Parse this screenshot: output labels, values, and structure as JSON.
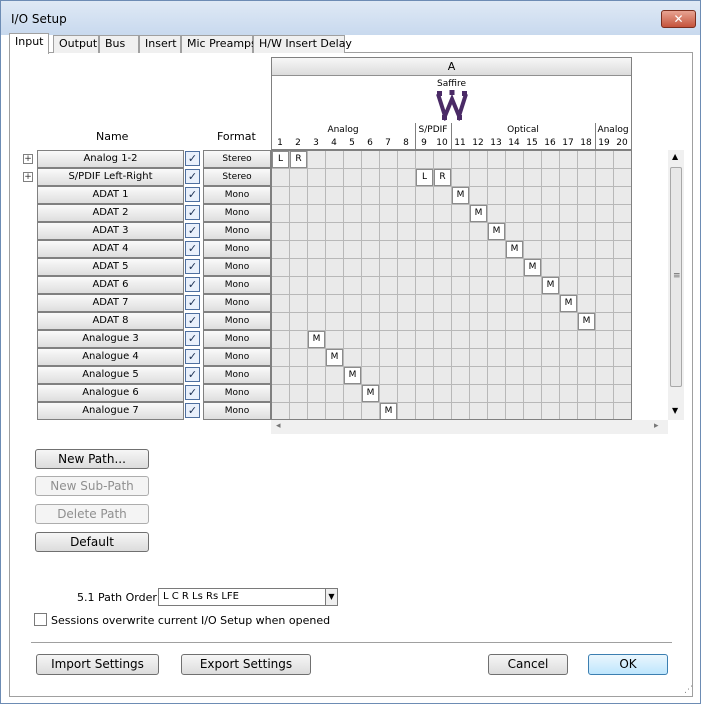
{
  "window": {
    "title": "I/O Setup",
    "close_label": "✕"
  },
  "tabs": [
    {
      "label": "Input",
      "active": true
    },
    {
      "label": "Output",
      "active": false
    },
    {
      "label": "Bus",
      "active": false
    },
    {
      "label": "Insert",
      "active": false
    },
    {
      "label": "Mic Preamps",
      "active": false
    },
    {
      "label": "H/W Insert Delay",
      "active": false
    }
  ],
  "columns": {
    "name": "Name",
    "format": "Format"
  },
  "device": {
    "section": "A",
    "name": "Saffire",
    "groups": [
      {
        "label": "Analog",
        "from": 1,
        "to": 8
      },
      {
        "label": "S/PDIF",
        "from": 9,
        "to": 10
      },
      {
        "label": "Optical",
        "from": 11,
        "to": 18
      },
      {
        "label": "Analog",
        "from": 19,
        "to": 20
      }
    ],
    "channels": [
      "1",
      "2",
      "3",
      "4",
      "5",
      "6",
      "7",
      "8",
      "9",
      "10",
      "11",
      "12",
      "13",
      "14",
      "15",
      "16",
      "17",
      "18",
      "19",
      "20"
    ]
  },
  "rows": [
    {
      "name": "Analog 1-2",
      "format": "Stereo",
      "expandable": true,
      "checked": true,
      "assign": [
        [
          1,
          "L"
        ],
        [
          2,
          "R"
        ]
      ]
    },
    {
      "name": "S/PDIF Left-Right",
      "format": "Stereo",
      "expandable": true,
      "checked": true,
      "assign": [
        [
          9,
          "L"
        ],
        [
          10,
          "R"
        ]
      ]
    },
    {
      "name": "ADAT 1",
      "format": "Mono",
      "expandable": false,
      "checked": true,
      "assign": [
        [
          11,
          "M"
        ]
      ]
    },
    {
      "name": "ADAT 2",
      "format": "Mono",
      "expandable": false,
      "checked": true,
      "assign": [
        [
          12,
          "M"
        ]
      ]
    },
    {
      "name": "ADAT 3",
      "format": "Mono",
      "expandable": false,
      "checked": true,
      "assign": [
        [
          13,
          "M"
        ]
      ]
    },
    {
      "name": "ADAT 4",
      "format": "Mono",
      "expandable": false,
      "checked": true,
      "assign": [
        [
          14,
          "M"
        ]
      ]
    },
    {
      "name": "ADAT 5",
      "format": "Mono",
      "expandable": false,
      "checked": true,
      "assign": [
        [
          15,
          "M"
        ]
      ]
    },
    {
      "name": "ADAT 6",
      "format": "Mono",
      "expandable": false,
      "checked": true,
      "assign": [
        [
          16,
          "M"
        ]
      ]
    },
    {
      "name": "ADAT 7",
      "format": "Mono",
      "expandable": false,
      "checked": true,
      "assign": [
        [
          17,
          "M"
        ]
      ]
    },
    {
      "name": "ADAT 8",
      "format": "Mono",
      "expandable": false,
      "checked": true,
      "assign": [
        [
          18,
          "M"
        ]
      ]
    },
    {
      "name": "Analogue 3",
      "format": "Mono",
      "expandable": false,
      "checked": true,
      "assign": [
        [
          3,
          "M"
        ]
      ]
    },
    {
      "name": "Analogue 4",
      "format": "Mono",
      "expandable": false,
      "checked": true,
      "assign": [
        [
          4,
          "M"
        ]
      ]
    },
    {
      "name": "Analogue 5",
      "format": "Mono",
      "expandable": false,
      "checked": true,
      "assign": [
        [
          5,
          "M"
        ]
      ]
    },
    {
      "name": "Analogue 6",
      "format": "Mono",
      "expandable": false,
      "checked": true,
      "assign": [
        [
          6,
          "M"
        ]
      ]
    },
    {
      "name": "Analogue 7",
      "format": "Mono",
      "expandable": false,
      "checked": true,
      "assign": [
        [
          7,
          "M"
        ]
      ]
    }
  ],
  "path_buttons": {
    "new_path": "New Path...",
    "new_sub_path": "New Sub-Path",
    "delete_path": "Delete Path",
    "default": "Default"
  },
  "path_order": {
    "label": "5.1 Path Order:",
    "value": "L C R Ls Rs LFE"
  },
  "overwrite_option": {
    "label": "Sessions overwrite current I/O Setup when opened",
    "checked": false
  },
  "footer": {
    "import": "Import Settings",
    "export": "Export Settings",
    "cancel": "Cancel",
    "ok": "OK"
  },
  "icons": {
    "expand": "plus-icon",
    "check": "checkmark-icon",
    "logo": "saffire-logo",
    "grip": "resize-grip-icon"
  }
}
